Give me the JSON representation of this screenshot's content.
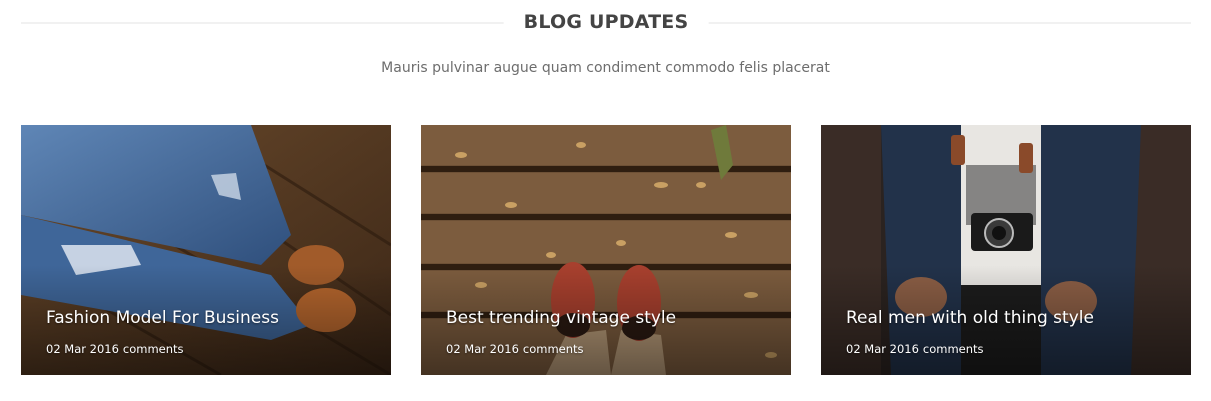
{
  "section": {
    "title": "BLOG UPDATES",
    "subtitle": "Mauris pulvinar augue quam condiment commodo felis placerat"
  },
  "posts": [
    {
      "title": "Fashion Model For Business",
      "date": "02 Mar 2016",
      "comments": "comments",
      "image": "jeans-boots-on-wood-photo"
    },
    {
      "title": "Best trending vintage style",
      "date": "02 Mar 2016",
      "comments": "comments",
      "image": "red-sneakers-on-wooden-deck-photo"
    },
    {
      "title": "Real men with old thing style",
      "date": "02 Mar 2016",
      "comments": "comments",
      "image": "man-with-camera-photo"
    }
  ],
  "colors": {
    "title_text": "#444444",
    "subtitle_text": "#6d6d6d",
    "divider": "#f1f1f1",
    "card_text": "#ffffff"
  }
}
